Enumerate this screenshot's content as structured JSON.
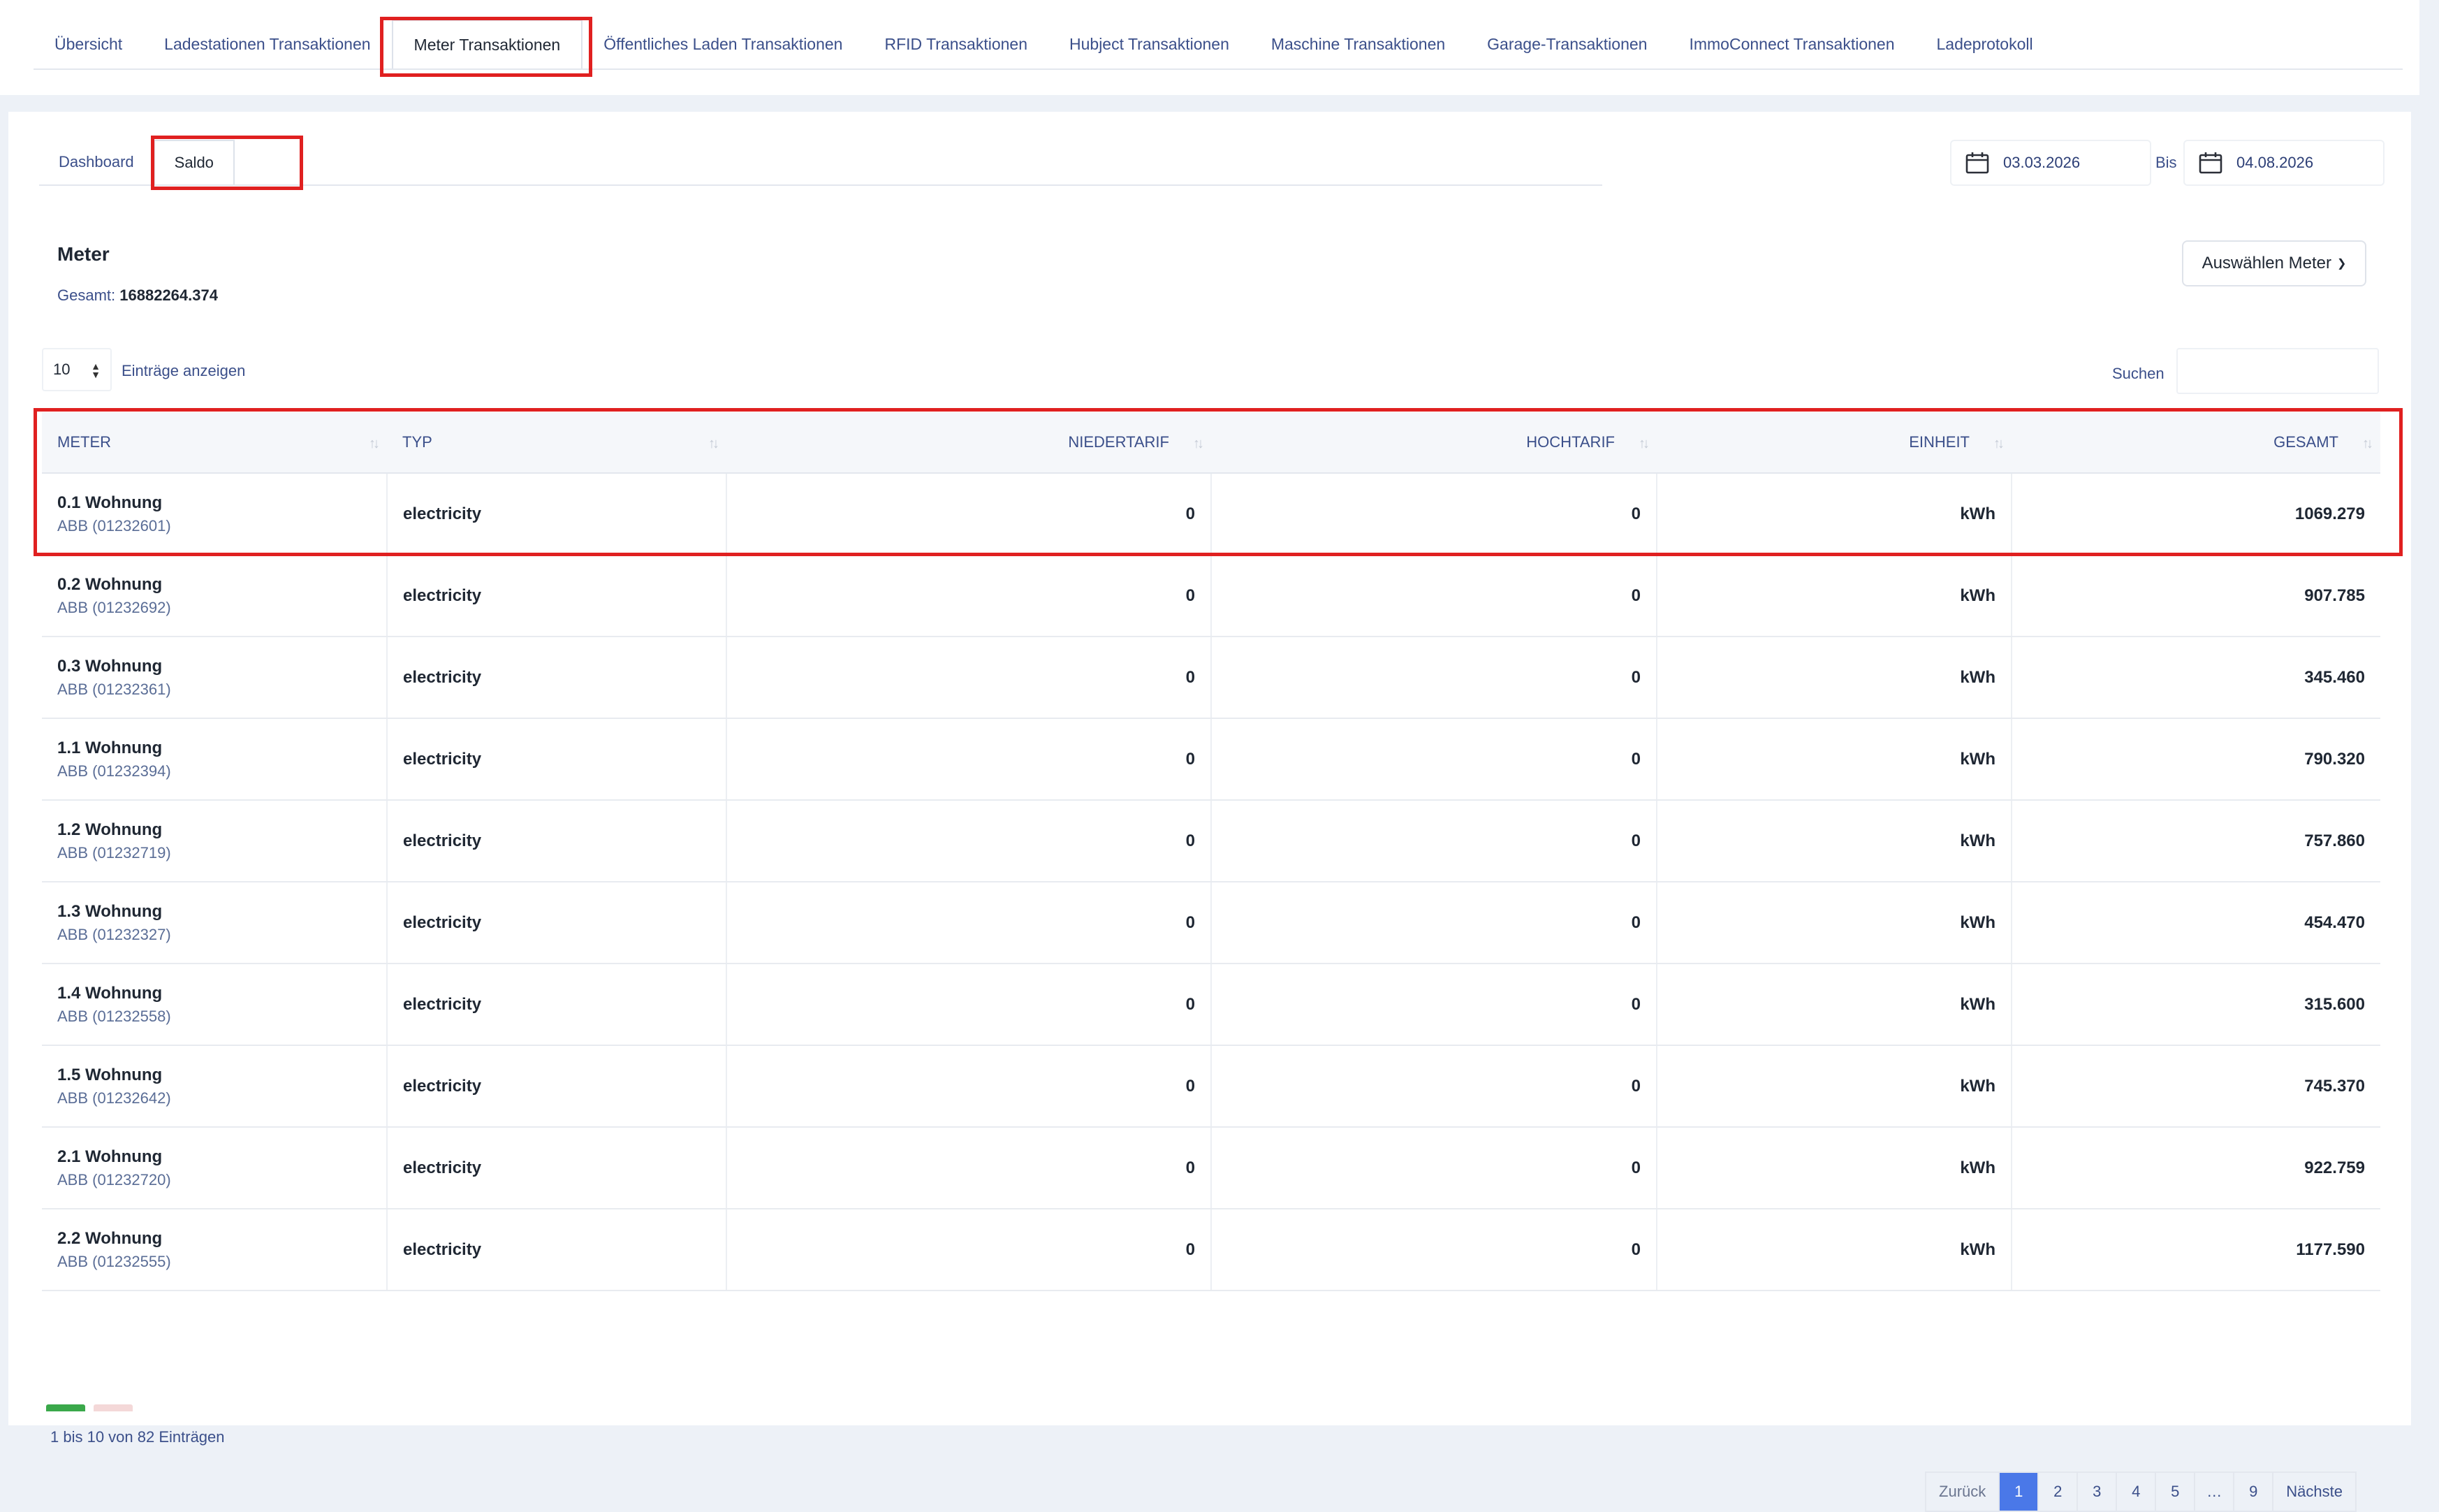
{
  "top_tabs": [
    {
      "label": "Übersicht"
    },
    {
      "label": "Ladestationen Transaktionen"
    },
    {
      "label": "Meter Transaktionen"
    },
    {
      "label": "Öffentliches Laden Transaktionen"
    },
    {
      "label": "RFID Transaktionen"
    },
    {
      "label": "Hubject Transaktionen"
    },
    {
      "label": "Maschine Transaktionen"
    },
    {
      "label": "Garage-Transaktionen"
    },
    {
      "label": "ImmoConnect Transaktionen"
    },
    {
      "label": "Ladeprotokoll"
    }
  ],
  "sub_tabs": [
    {
      "label": "Dashboard"
    },
    {
      "label": "Saldo"
    }
  ],
  "date_range": {
    "from": "03.03.2026",
    "separator": "Bis",
    "to": "04.08.2026"
  },
  "section": {
    "title": "Meter",
    "total_label": "Gesamt:",
    "total_value": "16882264.374",
    "select_button": "Auswählen Meter"
  },
  "table_controls": {
    "page_length": "10",
    "page_length_label": "Einträge anzeigen",
    "search_label": "Suchen",
    "search_value": ""
  },
  "table": {
    "columns": [
      "METER",
      "TYP",
      "NIEDERTARIF",
      "HOCHTARIF",
      "EINHEIT",
      "GESAMT"
    ],
    "rows": [
      {
        "meter": "0.1 Wohnung",
        "device": "ABB (01232601)",
        "typ": "electricity",
        "nieder": "0",
        "hoch": "0",
        "einheit": "kWh",
        "gesamt": "1069.279"
      },
      {
        "meter": "0.2 Wohnung",
        "device": "ABB (01232692)",
        "typ": "electricity",
        "nieder": "0",
        "hoch": "0",
        "einheit": "kWh",
        "gesamt": "907.785"
      },
      {
        "meter": "0.3 Wohnung",
        "device": "ABB (01232361)",
        "typ": "electricity",
        "nieder": "0",
        "hoch": "0",
        "einheit": "kWh",
        "gesamt": "345.460"
      },
      {
        "meter": "1.1 Wohnung",
        "device": "ABB (01232394)",
        "typ": "electricity",
        "nieder": "0",
        "hoch": "0",
        "einheit": "kWh",
        "gesamt": "790.320"
      },
      {
        "meter": "1.2 Wohnung",
        "device": "ABB (01232719)",
        "typ": "electricity",
        "nieder": "0",
        "hoch": "0",
        "einheit": "kWh",
        "gesamt": "757.860"
      },
      {
        "meter": "1.3 Wohnung",
        "device": "ABB (01232327)",
        "typ": "electricity",
        "nieder": "0",
        "hoch": "0",
        "einheit": "kWh",
        "gesamt": "454.470"
      },
      {
        "meter": "1.4 Wohnung",
        "device": "ABB (01232558)",
        "typ": "electricity",
        "nieder": "0",
        "hoch": "0",
        "einheit": "kWh",
        "gesamt": "315.600"
      },
      {
        "meter": "1.5 Wohnung",
        "device": "ABB (01232642)",
        "typ": "electricity",
        "nieder": "0",
        "hoch": "0",
        "einheit": "kWh",
        "gesamt": "745.370"
      },
      {
        "meter": "2.1 Wohnung",
        "device": "ABB (01232720)",
        "typ": "electricity",
        "nieder": "0",
        "hoch": "0",
        "einheit": "kWh",
        "gesamt": "922.759"
      },
      {
        "meter": "2.2 Wohnung",
        "device": "ABB (01232555)",
        "typ": "electricity",
        "nieder": "0",
        "hoch": "0",
        "einheit": "kWh",
        "gesamt": "1177.590"
      }
    ]
  },
  "footer": {
    "info": "1 bis 10 von 82 Einträgen",
    "pagination": [
      "Zurück",
      "1",
      "2",
      "3",
      "4",
      "5",
      "…",
      "9",
      "Nächste"
    ]
  },
  "colors": {
    "highlight": "#e02020",
    "link": "#3b4f8a",
    "pagination_active": "#4a78e8"
  }
}
